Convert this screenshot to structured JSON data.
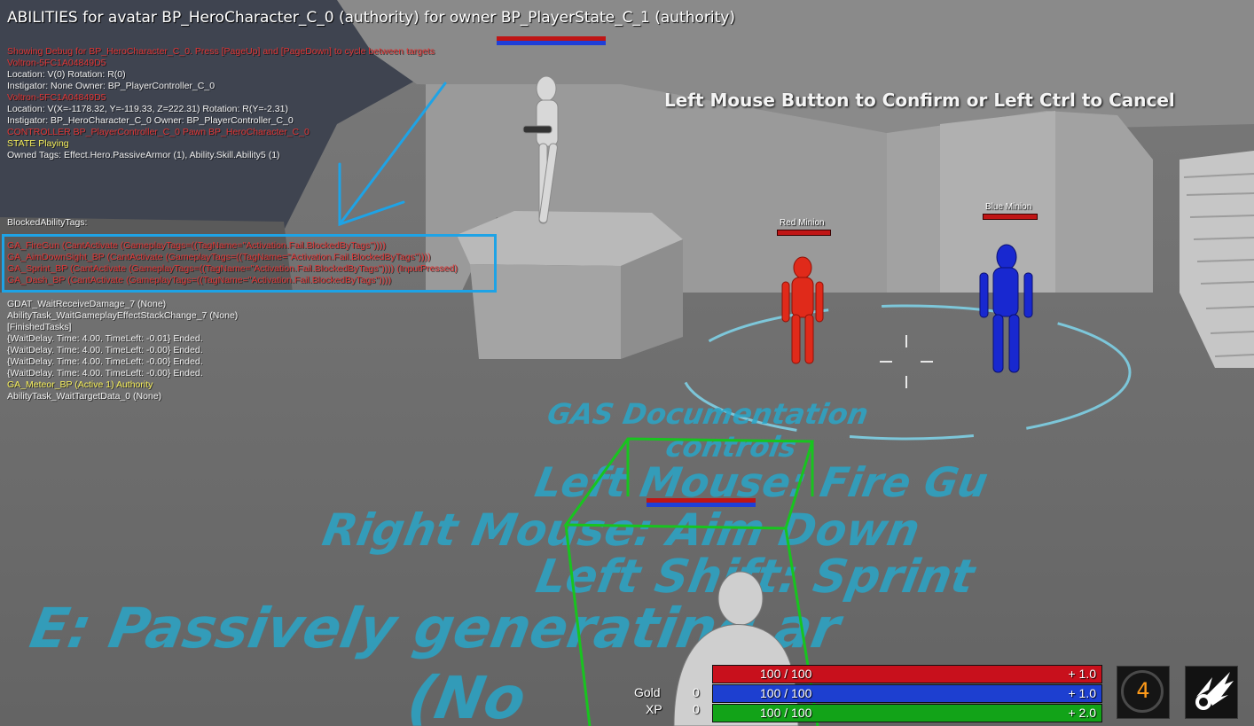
{
  "window_title": "ABILITIES for avatar BP_HeroCharacter_C_0 (authority) for owner BP_PlayerState_C_1 (authority)",
  "center_message": "Left Mouse Button to Confirm or Left Ctrl to Cancel",
  "debug_lines": [
    {
      "text": "Showing Debug for BP_HeroCharacter_C_0. Press [PageUp] and [PageDown] to cycle between targets",
      "color": "red"
    },
    {
      "text": "Voltron-5FC1A04849D5",
      "color": "red"
    },
    {
      "text": "Location: V(0) Rotation: R(0)",
      "color": "white"
    },
    {
      "text": " Instigator: None Owner: BP_PlayerController_C_0",
      "color": "white"
    },
    {
      "text": "Voltron-5FC1A04849D5",
      "color": "red"
    },
    {
      "text": "Location: V(X=-1178.32, Y=-119.33, Z=222.31) Rotation: R(Y=-2.31)",
      "color": "white"
    },
    {
      "text": " Instigator: BP_HeroCharacter_C_0 Owner: BP_PlayerController_C_0",
      "color": "white"
    },
    {
      "text": "CONTROLLER BP_PlayerController_C_0 Pawn BP_HeroCharacter_C_0",
      "color": "red"
    },
    {
      "text": "STATE Playing",
      "color": "yellow"
    },
    {
      "text": "Owned Tags: Effect.Hero.PassiveArmor (1), Ability.Skill.Ability5 (1)",
      "color": "white"
    }
  ],
  "blocked_header": "BlockedAbilityTags:",
  "blocked_lines": [
    {
      "text": "GA_FireGun  (CantActivate (GameplayTags=((TagName=\"Activation.Fail.BlockedByTags\"))))",
      "color": "red"
    },
    {
      "text": "GA_AimDownSight_BP  (CantActivate (GameplayTags=((TagName=\"Activation.Fail.BlockedByTags\"))))",
      "color": "red"
    },
    {
      "text": "GA_Sprint_BP  (CantActivate (GameplayTags=((TagName=\"Activation.Fail.BlockedByTags\")))) (InputPressed)",
      "color": "red"
    },
    {
      "text": "GA_Dash_BP  (CantActivate (GameplayTags=((TagName=\"Activation.Fail.BlockedByTags\"))))",
      "color": "red"
    }
  ],
  "task_lines": [
    {
      "text": " GDAT_WaitReceiveDamage_7 (None)",
      "color": "white"
    },
    {
      "text": " AbilityTask_WaitGameplayEffectStackChange_7 (None)",
      "color": "white"
    },
    {
      "text": " [FinishedTasks]",
      "color": "white"
    },
    {
      "text": "  {WaitDelay. Time: 4.00. TimeLeft: -0.01} Ended.",
      "color": "white"
    },
    {
      "text": "  {WaitDelay. Time: 4.00. TimeLeft: -0.00} Ended.",
      "color": "white"
    },
    {
      "text": "  {WaitDelay. Time: 4.00. TimeLeft: -0.00} Ended.",
      "color": "white"
    },
    {
      "text": "  {WaitDelay. Time: 4.00. TimeLeft: -0.00} Ended.",
      "color": "white"
    },
    {
      "text": "GA_Meteor_BP  (Active 1)  Authority",
      "color": "yellow"
    },
    {
      "text": " AbilityTask_WaitTargetData_0 (None)",
      "color": "white"
    }
  ],
  "minions": {
    "red": {
      "label": "Red Minion"
    },
    "blue": {
      "label": "Blue Minion"
    }
  },
  "floor_text": {
    "line1": "GAS Documentation",
    "line2": "controls",
    "line3": "Left Mouse: Fire Gu",
    "line4": "Right Mouse: Aim Down",
    "line5": "Left Shift: Sprint",
    "line6": "E: Passively generating ar",
    "line7": "(No"
  },
  "hud": {
    "health": {
      "value": "100 / 100",
      "regen": "+ 1.0",
      "fill": 1.0,
      "color": "#c8101c"
    },
    "mana": {
      "value": "100 / 100",
      "regen": "+ 1.0",
      "fill": 1.0,
      "color": "#1d3fd0"
    },
    "stamina": {
      "value": "100 / 100",
      "regen": "+ 2.0",
      "fill": 1.0,
      "color": "#12a318"
    },
    "gold_label": "Gold",
    "gold_value": "0",
    "xp_label": "XP",
    "xp_value": "0",
    "level": "4"
  },
  "colors": {
    "debug_red": "#e03535",
    "debug_yellow": "#f5ee5a",
    "highlight_box": "#1ea3e6",
    "target_box": "#18c41f",
    "floor_text": "#2aa6c8"
  }
}
